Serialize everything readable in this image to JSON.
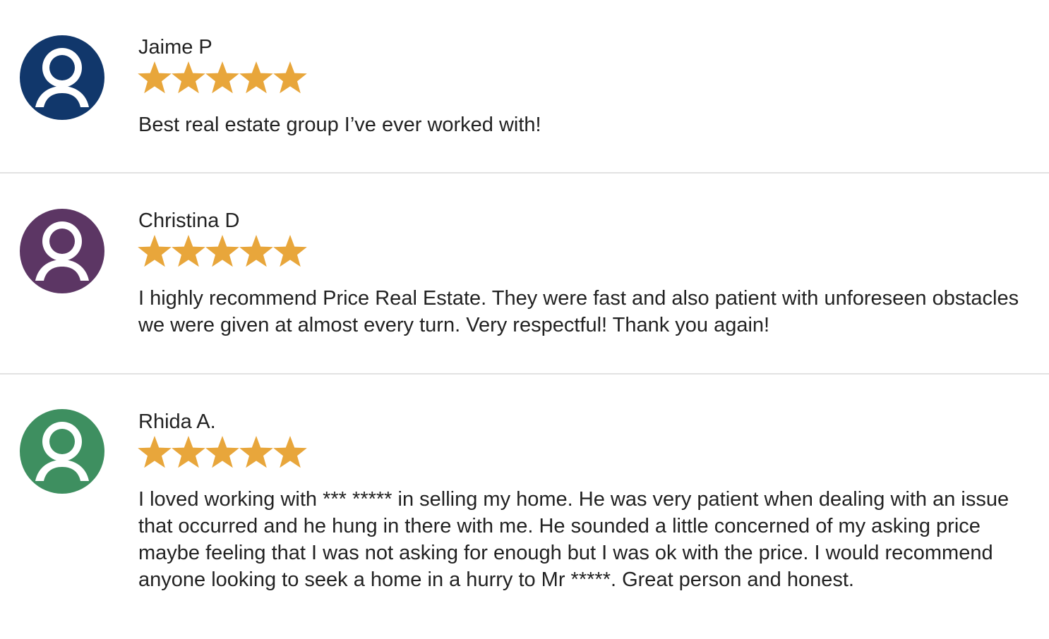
{
  "colors": {
    "star": "#E8A63B",
    "divider": "#E2E2E2",
    "text": "#222222"
  },
  "reviews": [
    {
      "name": "Jaime P",
      "rating": 5,
      "avatar_color": "#11376B",
      "avatar_icon": "user-icon",
      "text": "Best real estate group I’ve ever worked with!"
    },
    {
      "name": "Christina D",
      "rating": 5,
      "avatar_color": "#5C3664",
      "avatar_icon": "user-icon",
      "text": "I highly recommend Price Real Estate. They were fast and also patient with unforeseen obstacles we were given at almost every turn. Very respectful! Thank you again!"
    },
    {
      "name": "Rhida A.",
      "rating": 5,
      "avatar_color": "#3E8F60",
      "avatar_icon": "user-icon",
      "text": "I loved working with *** ***** in selling my home. He was very patient when dealing with an issue that occurred and he hung in there with me. He sounded a little concerned of my asking price maybe feeling that I was not asking for enough but I was ok with the price. I would recommend anyone looking to seek a home in a hurry to Mr *****. Great person and honest."
    }
  ]
}
